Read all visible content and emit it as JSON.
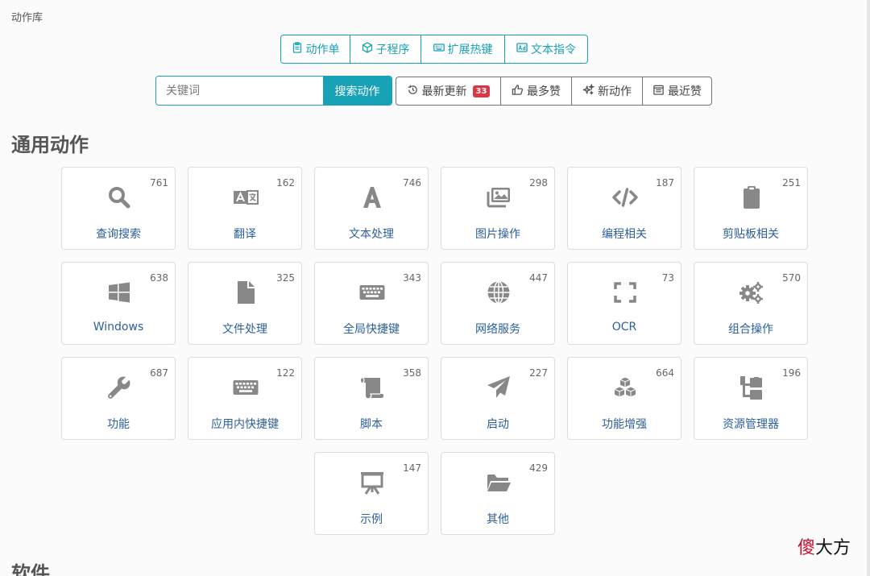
{
  "breadcrumb": "动作库",
  "top_tabs": [
    {
      "label": "动作单",
      "icon": "clipboard-icon"
    },
    {
      "label": "子程序",
      "icon": "cube-icon"
    },
    {
      "label": "扩展热键",
      "icon": "keyboard-icon"
    },
    {
      "label": "文本指令",
      "icon": "ad-text-icon"
    }
  ],
  "search": {
    "placeholder": "关键词",
    "value": "",
    "button_label": "搜索动作"
  },
  "sort_buttons": [
    {
      "label": "最新更新",
      "icon": "history-icon",
      "badge": "33"
    },
    {
      "label": "最多赞",
      "icon": "thumbs-up-icon"
    },
    {
      "label": "新动作",
      "icon": "sparkle-icon"
    },
    {
      "label": "最近赞",
      "icon": "calendar-icon"
    }
  ],
  "sections": [
    {
      "title": "通用动作"
    },
    {
      "title": "软件"
    }
  ],
  "categories": [
    {
      "label": "查询搜索",
      "count": "761",
      "icon": "search-icon"
    },
    {
      "label": "翻译",
      "count": "162",
      "icon": "translate-icon"
    },
    {
      "label": "文本处理",
      "count": "746",
      "icon": "font-icon"
    },
    {
      "label": "图片操作",
      "count": "298",
      "icon": "images-icon"
    },
    {
      "label": "编程相关",
      "count": "187",
      "icon": "code-icon"
    },
    {
      "label": "剪贴板相关",
      "count": "251",
      "icon": "clipboard-icon"
    },
    {
      "label": "Windows",
      "count": "638",
      "icon": "windows-icon"
    },
    {
      "label": "文件处理",
      "count": "325",
      "icon": "file-icon"
    },
    {
      "label": "全局快捷键",
      "count": "343",
      "icon": "keyboard-icon"
    },
    {
      "label": "网络服务",
      "count": "447",
      "icon": "globe-icon"
    },
    {
      "label": "OCR",
      "count": "73",
      "icon": "expand-icon"
    },
    {
      "label": "组合操作",
      "count": "570",
      "icon": "cogs-icon"
    },
    {
      "label": "功能",
      "count": "687",
      "icon": "wrench-icon"
    },
    {
      "label": "应用内快捷键",
      "count": "122",
      "icon": "keyboard-icon"
    },
    {
      "label": "脚本",
      "count": "358",
      "icon": "scroll-icon"
    },
    {
      "label": "启动",
      "count": "227",
      "icon": "paper-plane-icon"
    },
    {
      "label": "功能增强",
      "count": "664",
      "icon": "cubes-icon"
    },
    {
      "label": "资源管理器",
      "count": "196",
      "icon": "sitemap-icon"
    },
    {
      "label": "示例",
      "count": "147",
      "icon": "presentation-icon"
    },
    {
      "label": "其他",
      "count": "429",
      "icon": "folder-open-icon"
    }
  ],
  "watermark": {
    "part1": "傻",
    "part2": "大方"
  },
  "colors": {
    "accent": "#17a2b8",
    "icon_gray": "#888888",
    "link": "#2c5f9a",
    "badge": "#dc3545"
  }
}
